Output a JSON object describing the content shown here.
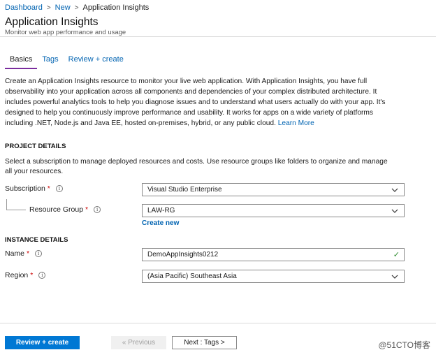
{
  "breadcrumb": {
    "items": [
      "Dashboard",
      "New"
    ],
    "separator": ">",
    "current": "Application Insights"
  },
  "header": {
    "title": "Application Insights",
    "subtitle": "Monitor web app performance and usage"
  },
  "tabs": [
    {
      "label": "Basics",
      "active": true
    },
    {
      "label": "Tags",
      "active": false
    },
    {
      "label": "Review + create",
      "active": false
    }
  ],
  "intro": {
    "text": "Create an Application Insights resource to monitor your live web application. With Application Insights, you have full observability into your application across all components and dependencies of your complex distributed architecture. It includes powerful analytics tools to help you diagnose issues and to understand what users actually do with your app. It's designed to help you continuously improve performance and usability. It works for apps on a wide variety of platforms including .NET, Node.js and Java EE, hosted on-premises, hybrid, or any public cloud.",
    "learn_more": "Learn More"
  },
  "project_details": {
    "heading": "PROJECT DETAILS",
    "description": "Select a subscription to manage deployed resources and costs. Use resource groups like folders to organize and manage all your resources.",
    "subscription": {
      "label": "Subscription",
      "required": "*",
      "value": "Visual Studio Enterprise"
    },
    "resource_group": {
      "label": "Resource Group",
      "required": "*",
      "value": "LAW-RG",
      "create_new": "Create new"
    }
  },
  "instance_details": {
    "heading": "INSTANCE DETAILS",
    "name": {
      "label": "Name",
      "required": "*",
      "value": "DemoAppInsights0212"
    },
    "region": {
      "label": "Region",
      "required": "*",
      "value": "(Asia Pacific) Southeast Asia"
    }
  },
  "footer": {
    "review_create": "Review + create",
    "previous": "« Previous",
    "next": "Next : Tags >"
  },
  "watermark": "@51CTO博客",
  "colors": {
    "link": "#0063b1",
    "primary_button": "#0078d4",
    "active_tab_underline": "#7b2d9e",
    "required": "#c00000",
    "valid_check": "#2e8b2e"
  },
  "icons": {
    "info": "info-circle-icon",
    "dropdown": "chevron-down-icon",
    "valid": "checkmark-icon"
  }
}
